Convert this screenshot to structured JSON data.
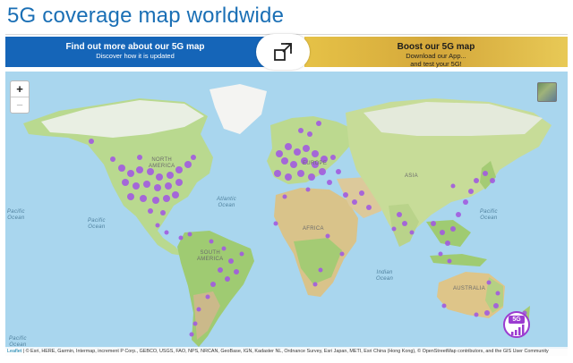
{
  "page": {
    "title": "5G coverage map worldwide"
  },
  "banner_left": {
    "line1": "Find out more about our 5G map",
    "line2": "Discover how it is updated"
  },
  "banner_right": {
    "line1": "Boost our 5G map",
    "line2": "Download our App...",
    "line3": "and test your 5G!"
  },
  "expand": {
    "icon": "expand-icon"
  },
  "map": {
    "zoom_in": "+",
    "zoom_out": "−",
    "labels": {
      "north": "NORTH",
      "america": "AMERICA",
      "south": "SOUTH",
      "s_america": "AMERICA",
      "europe": "EUROPE",
      "africa": "AFRICA",
      "asia": "ASIA",
      "australia": "AUSTRALIA",
      "atlantic": "Atlantic",
      "atlantic2": "Ocean",
      "pacific_l": "Pacific",
      "pacific_l2": "Ocean",
      "pacific_r": "Pacific",
      "pacific_r2": "Ocean",
      "pacific_bl": "Pacific",
      "pacific_bl2": "Ocean",
      "pacific_fr": "Pacific",
      "pacific_fr2": "Ocean",
      "indian": "Indian",
      "indian2": "Ocean"
    },
    "badge": {
      "label": "5G",
      "icon": "signal-bars-icon"
    },
    "attribution_leaflet": "Leaflet",
    "attribution_text": " | © Esri, HERE, Garmin, Intermap, increment P Corp., GEBCO, USGS, FAO, NPS, NRCAN, GeoBase, IGN, Kadaster NL, Ordnance Survey, Esri Japan, METI, Esri China (Hong Kong), © OpenStreetMap contributors, and the GIS User Community",
    "coverage_color": "#a25be0"
  }
}
